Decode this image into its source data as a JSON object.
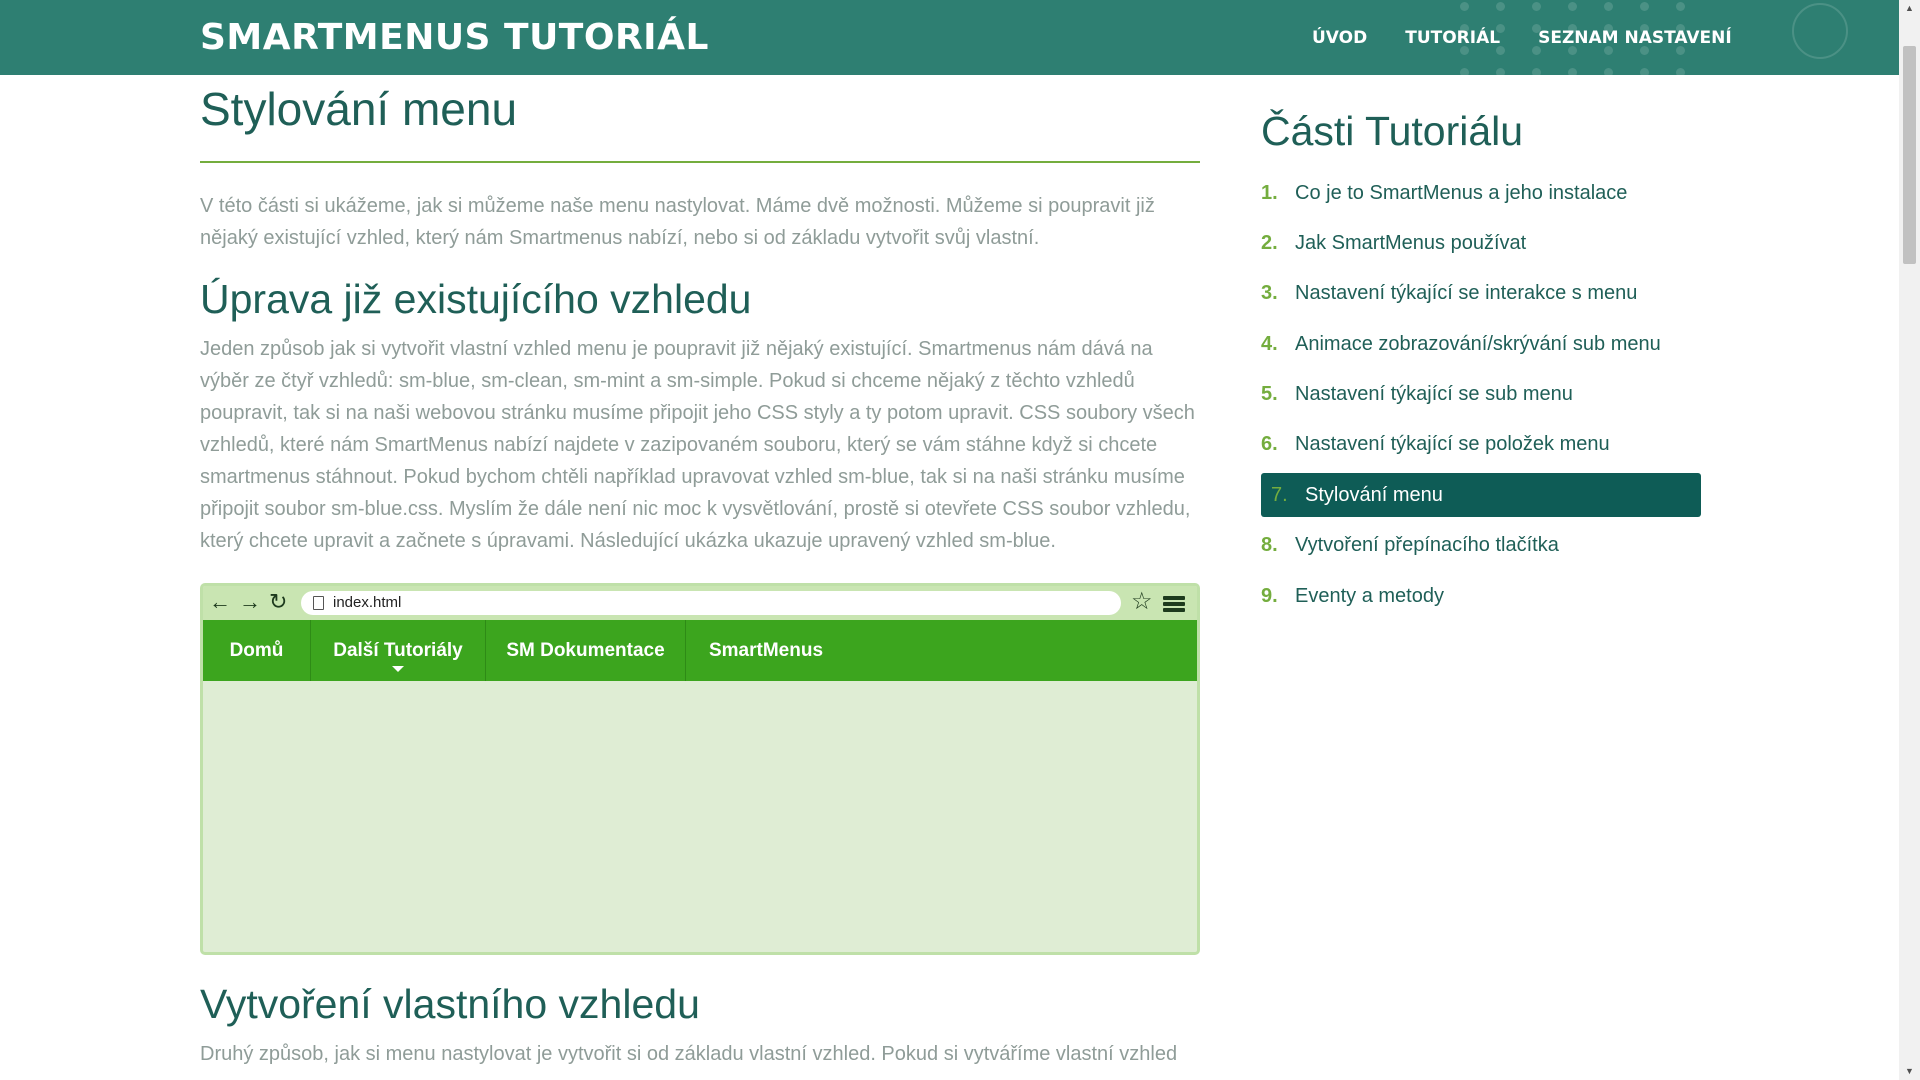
{
  "header": {
    "logo": "SMARTMENUS TUTORIÁL",
    "nav": [
      "ÚVOD",
      "TUTORIÁL",
      "SEZNAM NASTAVENÍ"
    ]
  },
  "main": {
    "title": "Stylování menu",
    "intro": "V této části si ukážeme, jak si můžeme naše menu nastylovat. Máme dvě možnosti. Můžeme si poupravit již nějaký existující vzhled, který nám Smartmenus nabízí, nebo si od základu vytvořit svůj vlastní.",
    "section1_heading": "Úprava již existujícího vzhledu",
    "section1_text": "Jeden způsob jak si vytvořit vlastní vzhled menu je poupravit již nějaký existující. Smartmenus nám dává na výběr ze čtyř vzhledů: sm-blue, sm-clean, sm-mint a sm-simple. Pokud si chceme nějaký z těchto vzhledů poupravit, tak si na naši webovou stránku musíme připojit jeho CSS styly a ty potom upravit. CSS soubory všech vzhledů, které nám SmartMenus nabízí najdete v zazipovaném souboru, který se vám stáhne když si chcete smartmenus stáhnout. Pokud bychom chtěli například upravovat vzhled sm-blue, tak si na naši stránku musíme připojit soubor sm-blue.css. Myslím že dále není nic moc k vysvětlování, prostě si otevřete CSS soubor vzhledu, který chcete upravit a začnete s úpravami. Následující ukázka ukazuje upravený vzhled sm-blue.",
    "section2_heading": "Vytvoření vlastního vzhledu",
    "section2_text": "Druhý způsob, jak si menu nastylovat je vytvořit si od základu vlastní vzhled. Pokud si vytváříme vlastní vzhled"
  },
  "demo": {
    "url": "index.html",
    "menu": [
      "Domů",
      "Další Tutoriály",
      "SM Dokumentace",
      "SmartMenus"
    ],
    "colors": {
      "menu_bg": "#3ca51e",
      "frame_bg": "#dfedd4",
      "toolbar_bg": "#c9e5b2"
    }
  },
  "sidebar": {
    "title": "Části Tutoriálu",
    "items": [
      {
        "num": "1.",
        "label": "Co je to SmartMenus a jeho instalace"
      },
      {
        "num": "2.",
        "label": "Jak SmartMenus používat"
      },
      {
        "num": "3.",
        "label": "Nastavení týkající se interakce s menu"
      },
      {
        "num": "4.",
        "label": "Animace zobrazování/skrývání sub menu"
      },
      {
        "num": "5.",
        "label": "Nastavení týkající se sub menu"
      },
      {
        "num": "6.",
        "label": "Nastavení týkající se položek menu"
      },
      {
        "num": "7.",
        "label": "Stylování menu"
      },
      {
        "num": "8.",
        "label": "Vytvoření přepínacího tlačítka"
      },
      {
        "num": "9.",
        "label": "Eventy a metody"
      }
    ],
    "active_index": 6
  },
  "colors": {
    "header_bg": "#2e7f72",
    "heading": "#1f5f57",
    "accent": "#74ad3e",
    "body_text": "#8f9c98",
    "active_item_bg": "#0e5c56"
  },
  "icons": [
    "back-arrow-icon",
    "forward-arrow-icon",
    "reload-icon",
    "document-icon",
    "star-icon",
    "hamburger-menu-icon",
    "scroll-up-icon",
    "scroll-down-icon"
  ]
}
